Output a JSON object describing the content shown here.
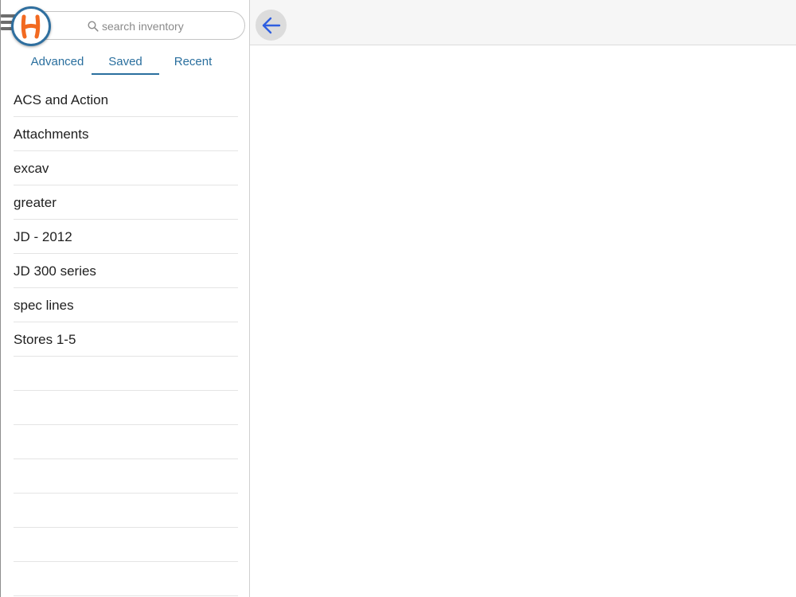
{
  "app": {
    "logo_letter": "H",
    "accent_color": "#2a6f9e",
    "logo_ring_color": "#2f6f9f",
    "logo_letter_color": "#f26a21"
  },
  "search": {
    "placeholder": "search inventory",
    "value": ""
  },
  "tabs": [
    {
      "label": "Advanced",
      "active": false
    },
    {
      "label": "Saved",
      "active": true
    },
    {
      "label": "Recent",
      "active": false
    }
  ],
  "saved_searches": [
    {
      "label": "ACS and Action"
    },
    {
      "label": "Attachments"
    },
    {
      "label": "excav"
    },
    {
      "label": "greater"
    },
    {
      "label": "JD - 2012"
    },
    {
      "label": "JD 300 series"
    },
    {
      "label": "spec lines"
    },
    {
      "label": "Stores 1-5"
    }
  ],
  "icons": {
    "menu": "hamburger-icon",
    "search": "magnifier-icon",
    "back": "arrow-left-icon"
  }
}
